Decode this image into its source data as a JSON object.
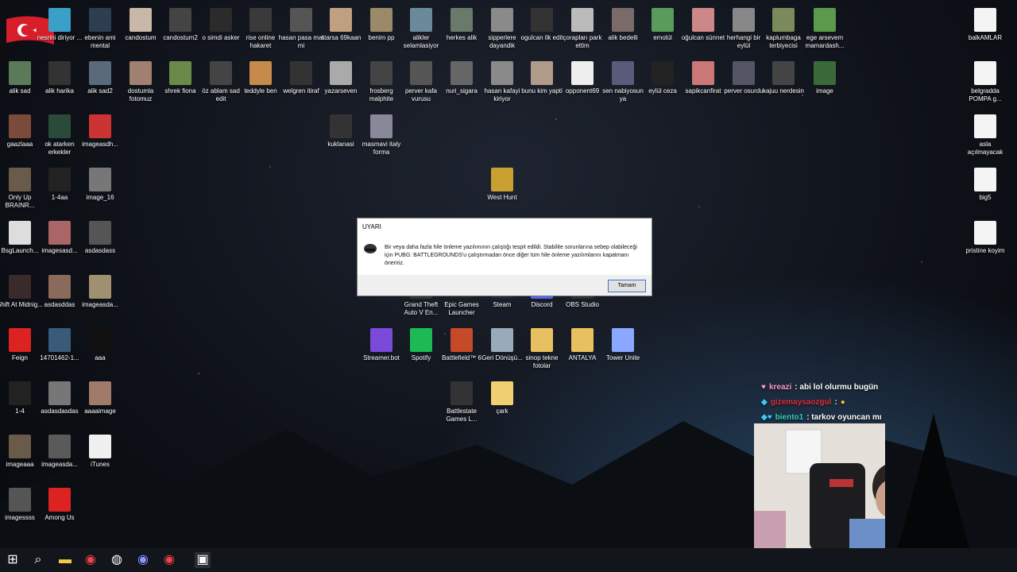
{
  "desktop": {
    "icons": [
      {
        "label": "nesrini diriyor ...",
        "color": "#3aa0c8"
      },
      {
        "label": "ebenin ami mental",
        "color": "#2c3e50"
      },
      {
        "label": "candostum",
        "color": "#c9b8a8"
      },
      {
        "label": "candostum2",
        "color": "#444"
      },
      {
        "label": "o simdi asker",
        "color": "#2b2b2b"
      },
      {
        "label": "rise online hakaret",
        "color": "#3a3a3a"
      },
      {
        "label": "hasan pasa mal mi",
        "color": "#555"
      },
      {
        "label": "atarsa 69kaan",
        "color": "#c0a080"
      },
      {
        "label": "benim pp",
        "color": "#9a8a6a"
      },
      {
        "label": "alikler selamlasiyor",
        "color": "#6a8a9a"
      },
      {
        "label": "herkes alik",
        "color": "#6a7a6a"
      },
      {
        "label": "sipperlere dayandik",
        "color": "#8a8a8a"
      },
      {
        "label": "ogulcan ilk edit",
        "color": "#333"
      },
      {
        "label": "çorapları park ettim",
        "color": "#bbb"
      },
      {
        "label": "alik bedelli",
        "color": "#7a6a6a"
      },
      {
        "label": "emolül",
        "color": "#5a9a5a"
      },
      {
        "label": "oğulcan sünnet",
        "color": "#c88"
      },
      {
        "label": "herhangi bir eylül",
        "color": "#888"
      },
      {
        "label": "kaplumbaga terbiyecisi",
        "color": "#7a8a5a"
      },
      {
        "label": "ege arsevem mamardash...",
        "color": "#5a9a4a"
      },
      {
        "label": "alik sad",
        "color": "#5a7a5a"
      },
      {
        "label": "alik harika",
        "color": "#333"
      },
      {
        "label": "alik sad2",
        "color": "#5a6a7a"
      },
      {
        "label": "dostumla fotomuz",
        "color": "#a08070"
      },
      {
        "label": "shrek fiona",
        "color": "#6a8a4a"
      },
      {
        "label": "öz ablam sad edit",
        "color": "#444"
      },
      {
        "label": "teddyle ben",
        "color": "#c88a4a"
      },
      {
        "label": "welgren itiraf",
        "color": "#333"
      },
      {
        "label": "yazarseven",
        "color": "#aaa"
      },
      {
        "label": "frosberg malphite",
        "color": "#444"
      },
      {
        "label": "perver kafa vurusu",
        "color": "#555"
      },
      {
        "label": "nuri_sigara",
        "color": "#666"
      },
      {
        "label": "hasan kafayi kiriyor",
        "color": "#8a8a8a"
      },
      {
        "label": "bunu kim yapti",
        "color": "#b09a8a"
      },
      {
        "label": "opponent69",
        "color": "#eee"
      },
      {
        "label": "sen nabiyosun ya",
        "color": "#5a5a7a"
      },
      {
        "label": "eylül ceza",
        "color": "#222"
      },
      {
        "label": "sapikcanfirat",
        "color": "#c77"
      },
      {
        "label": "perver osurdu",
        "color": "#556"
      },
      {
        "label": "kajuu nerdesin",
        "color": "#444"
      },
      {
        "label": "image",
        "color": "#3a6a3a"
      },
      {
        "label": "gaazlaaa",
        "color": "#7a4a3a"
      },
      {
        "label": "ok atarken erkekler",
        "color": "#2a4a3a"
      },
      {
        "label": "imageasdh...",
        "color": "#c33"
      },
      {
        "label": "kuklanasi",
        "color": "#333"
      },
      {
        "label": "masmavi italy forma",
        "color": "#889"
      },
      {
        "label": "West Hunt",
        "color": "#c9a030"
      },
      {
        "label": "Only Up BRAINR...",
        "color": "#6a5a4a"
      },
      {
        "label": "1-4aa",
        "color": "#222"
      },
      {
        "label": "image_16",
        "color": "#777"
      },
      {
        "label": "BsgLaunch...",
        "color": "#ddd"
      },
      {
        "label": "imagesasd...",
        "color": "#a66"
      },
      {
        "label": "asdasdass",
        "color": "#555"
      },
      {
        "label": "Shift At Midnig...",
        "color": "#3a2a2a"
      },
      {
        "label": "asdasddas",
        "color": "#8a6a5a"
      },
      {
        "label": "imageasda...",
        "color": "#a09070"
      },
      {
        "label": "Feign",
        "color": "#d22"
      },
      {
        "label": "14701462-1...",
        "color": "#3a5a7a"
      },
      {
        "label": "aaa",
        "color": "#111"
      },
      {
        "label": "1-4",
        "color": "#222"
      },
      {
        "label": "asdasdasdas",
        "color": "#777"
      },
      {
        "label": "aaaaimage",
        "color": "#a07a6a"
      },
      {
        "label": "imageaaa",
        "color": "#6a5a4a"
      },
      {
        "label": "imageasda...",
        "color": "#5a5a5a"
      },
      {
        "label": "iTunes",
        "color": "#f0f0f0"
      },
      {
        "label": "imagessss",
        "color": "#555"
      },
      {
        "label": "Among Us",
        "color": "#d22"
      },
      {
        "label": "Grand Theft Auto V En...",
        "color": "#333"
      },
      {
        "label": "Epic Games Launcher",
        "color": "#222"
      },
      {
        "label": "Steam",
        "color": "#1b2838"
      },
      {
        "label": "Discord",
        "color": "#5865f2"
      },
      {
        "label": "OBS Studio",
        "color": "#302e31"
      },
      {
        "label": "Streamer.bot",
        "color": "#7a4ad8"
      },
      {
        "label": "Spotify",
        "color": "#1db954"
      },
      {
        "label": "Battlefield™ 6",
        "color": "#c64a2a"
      },
      {
        "label": "Geri Dönüşü...",
        "color": "#9ab"
      },
      {
        "label": "sinop tekne fotolar",
        "color": "#e8c060"
      },
      {
        "label": "ANTALYA",
        "color": "#e8c060"
      },
      {
        "label": "Tower Unite",
        "color": "#8aa8ff"
      },
      {
        "label": "Battlestate Games L...",
        "color": "#333"
      },
      {
        "label": "çark",
        "color": "#f0d070"
      },
      {
        "label": "balkAMLAR",
        "color": "#f4f4f4"
      },
      {
        "label": "belgradda POMPA g...",
        "color": "#f4f4f4"
      },
      {
        "label": "asla açılmayacak",
        "color": "#f4f4f4"
      },
      {
        "label": "big5",
        "color": "#f4f4f4"
      },
      {
        "label": "pristine koyim",
        "color": "#f4f4f4"
      }
    ]
  },
  "dialog": {
    "title": "UYARI",
    "message": "Bir veya daha fazla hile önleme yazılımının çalıştığı tespit edildi. Stabilite sorunlarına sebep olabileceği için PUBG: BATTLEGROUNDS'u çalıştırmadan önce diğer tüm hile önleme yazılımlarını kapatmanı öneririz.",
    "ok_label": "Tamam"
  },
  "chat": [
    {
      "user": "kreazi",
      "user_color": "#ff9ac8",
      "text": ": abi lol olurmu bugün"
    },
    {
      "user": "gizemaysaozgul",
      "user_color": "#e03040",
      "text": ":"
    },
    {
      "user": "biento1",
      "user_color": "#3ad0c8",
      "text": ": tarkov oyuncan mı"
    }
  ],
  "taskbar": {
    "items": [
      "start",
      "search",
      "file-explorer",
      "chrome",
      "obs",
      "discord",
      "chrome2",
      "pubg"
    ]
  }
}
